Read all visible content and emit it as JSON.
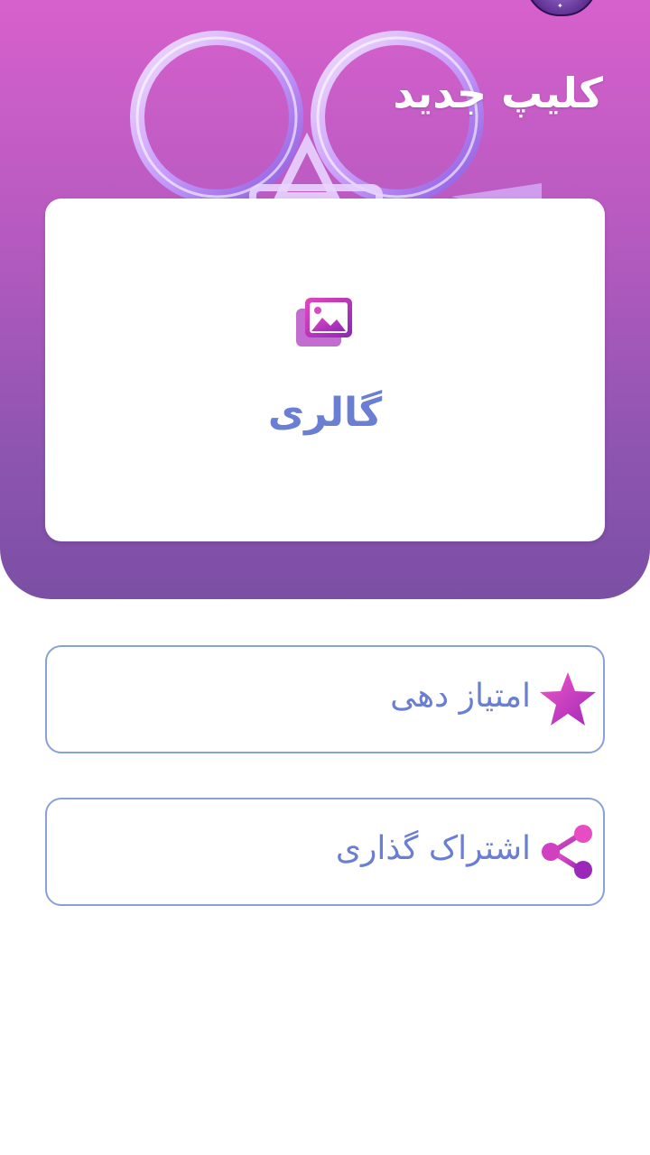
{
  "header": {
    "title": "کلیپ جدید"
  },
  "gallery": {
    "label": "گالری",
    "icon": "gallery-icon"
  },
  "menu": {
    "rate_label": "امتیاز دهی",
    "rate_icon": "star-icon",
    "share_label": "اشتراک گذاری",
    "share_icon": "share-icon"
  },
  "colors": {
    "header_top": "#d760cc",
    "header_bottom": "#7b4fa5",
    "label_blue": "#6a7fd4",
    "icon_pink": "#e040b8",
    "icon_purple": "#9a2ab8",
    "button_border": "#8aa0d8"
  }
}
